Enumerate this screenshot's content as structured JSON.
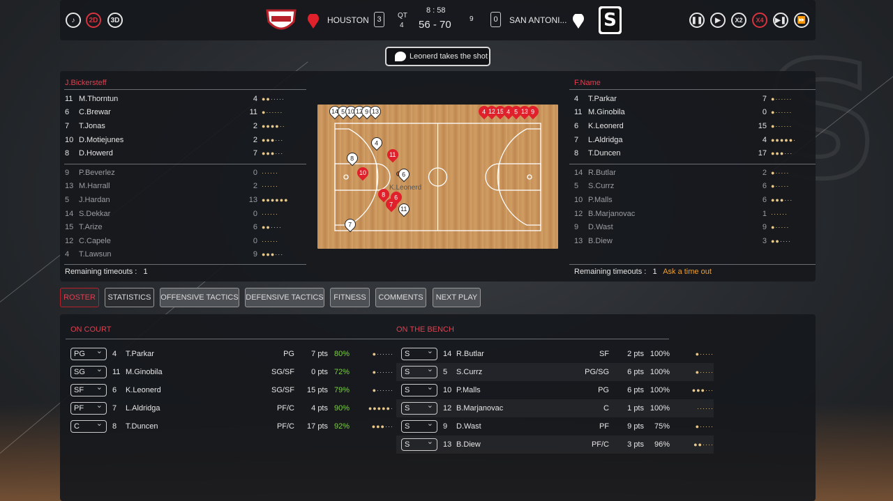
{
  "controls": {
    "speed_2d": "2D",
    "speed_3d": "3D",
    "x2": "X2",
    "x4": "X4"
  },
  "match": {
    "home_team": "HOUSTON",
    "home_fouls": "3",
    "qt_label": "QT",
    "quarter": "4",
    "clock": "8 : 58",
    "score": "56 - 70",
    "shot_clock": "9",
    "away_fouls": "0",
    "away_team": "SAN ANTONI...",
    "away_logo_letter": "S"
  },
  "event": "Leonerd takes the shot",
  "home": {
    "coach": "J.Bickersteff",
    "starters": [
      {
        "num": "11",
        "name": "M.Thorntun",
        "pts": "4",
        "dots": "●●·····"
      },
      {
        "num": "6",
        "name": "C.Brewar",
        "pts": "11",
        "dots": "●······"
      },
      {
        "num": "7",
        "name": "T.Jonas",
        "pts": "2",
        "dots": "●●●●··"
      },
      {
        "num": "10",
        "name": "D.Motiejunes",
        "pts": "2",
        "dots": "●●●···"
      },
      {
        "num": "8",
        "name": "D.Howerd",
        "pts": "7",
        "dots": "●●●···"
      }
    ],
    "bench": [
      {
        "num": "9",
        "name": "P.Beverlez",
        "pts": "0",
        "dots": "······"
      },
      {
        "num": "13",
        "name": "M.Harrall",
        "pts": "2",
        "dots": "······"
      },
      {
        "num": "5",
        "name": "J.Hardan",
        "pts": "13",
        "dots": "●●●●●●"
      },
      {
        "num": "14",
        "name": "S.Dekkar",
        "pts": "0",
        "dots": "······"
      },
      {
        "num": "15",
        "name": "T.Arize",
        "pts": "6",
        "dots": "●●····"
      },
      {
        "num": "12",
        "name": "C.Capele",
        "pts": "0",
        "dots": "······"
      },
      {
        "num": "4",
        "name": "T.Lawsun",
        "pts": "9",
        "dots": "●●●···"
      }
    ],
    "timeouts_label": "Remaining timeouts :",
    "timeouts": "1"
  },
  "away": {
    "coach": "F.Name",
    "starters": [
      {
        "num": "4",
        "name": "T.Parkar",
        "pts": "7",
        "dots": "●······"
      },
      {
        "num": "11",
        "name": "M.Ginobila",
        "pts": "0",
        "dots": "●······"
      },
      {
        "num": "6",
        "name": "K.Leonerd",
        "pts": "15",
        "dots": "●······"
      },
      {
        "num": "7",
        "name": "L.Aldridga",
        "pts": "4",
        "dots": "●●●●●·"
      },
      {
        "num": "8",
        "name": "T.Duncen",
        "pts": "17",
        "dots": "●●●···"
      }
    ],
    "bench": [
      {
        "num": "14",
        "name": "R.Butlar",
        "pts": "2",
        "dots": "●·····"
      },
      {
        "num": "5",
        "name": "S.Currz",
        "pts": "6",
        "dots": "●·····"
      },
      {
        "num": "10",
        "name": "P.Malls",
        "pts": "6",
        "dots": "●●●···"
      },
      {
        "num": "12",
        "name": "B.Marjanovac",
        "pts": "1",
        "dots": "······"
      },
      {
        "num": "9",
        "name": "D.Wast",
        "pts": "9",
        "dots": "●·····"
      },
      {
        "num": "13",
        "name": "B.Diew",
        "pts": "3",
        "dots": "●●····"
      }
    ],
    "timeouts_label": "Remaining timeouts :",
    "timeouts": "1",
    "ask_timeout": "Ask a time out"
  },
  "court": {
    "ball_carrier": "K.Leonerd"
  },
  "tabs": [
    "ROSTER",
    "STATISTICS",
    "OFFENSIVE TACTICS",
    "DEFENSIVE TACTICS",
    "FITNESS",
    "COMMENTS",
    "NEXT PLAY"
  ],
  "roster": {
    "on_court_label": "ON COURT",
    "bench_label": "ON THE BENCH",
    "on_court": [
      {
        "slot": "PG",
        "num": "4",
        "name": "T.Parkar",
        "pos": "PG",
        "pts": "7 pts",
        "fit": "80%",
        "dots": "●······"
      },
      {
        "slot": "SG",
        "num": "11",
        "name": "M.Ginobila",
        "pos": "SG/SF",
        "pts": "0 pts",
        "fit": "72%",
        "dots": "●······"
      },
      {
        "slot": "SF",
        "num": "6",
        "name": "K.Leonerd",
        "pos": "SG/SF",
        "pts": "15 pts",
        "fit": "79%",
        "dots": "●······"
      },
      {
        "slot": "PF",
        "num": "7",
        "name": "L.Aldridga",
        "pos": "PF/C",
        "pts": "4 pts",
        "fit": "90%",
        "dots": "●●●●●·"
      },
      {
        "slot": "C",
        "num": "8",
        "name": "T.Duncen",
        "pos": "PF/C",
        "pts": "17 pts",
        "fit": "92%",
        "dots": "●●●···"
      }
    ],
    "bench": [
      {
        "slot": "S",
        "num": "14",
        "name": "R.Butlar",
        "pos": "SF",
        "pts": "2 pts",
        "fit": "100%",
        "dots": "●·····"
      },
      {
        "slot": "S",
        "num": "5",
        "name": "S.Currz",
        "pos": "PG/SG",
        "pts": "6 pts",
        "fit": "100%",
        "dots": "●·····"
      },
      {
        "slot": "S",
        "num": "10",
        "name": "P.Malls",
        "pos": "PG",
        "pts": "6 pts",
        "fit": "100%",
        "dots": "●●●···"
      },
      {
        "slot": "S",
        "num": "12",
        "name": "B.Marjanovac",
        "pos": "C",
        "pts": "1 pts",
        "fit": "100%",
        "dots": "······"
      },
      {
        "slot": "S",
        "num": "9",
        "name": "D.Wast",
        "pos": "PF",
        "pts": "9 pts",
        "fit": "75%",
        "dots": "●·····"
      },
      {
        "slot": "S",
        "num": "13",
        "name": "B.Diew",
        "pos": "PF/C",
        "pts": "3 pts",
        "fit": "96%",
        "dots": "●●····"
      }
    ]
  },
  "colors": {
    "accent": "#e04050",
    "fitness": "#7bd13f",
    "pip": "#e8c88a"
  }
}
